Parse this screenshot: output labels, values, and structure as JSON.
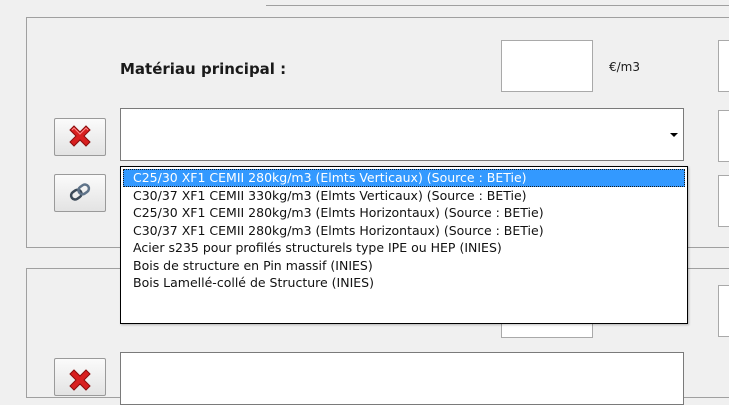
{
  "section1": {
    "label": "Matériau principal :",
    "price_unit": "€/m3",
    "price_value": "",
    "combo_value": ""
  },
  "dropdown": {
    "options": [
      "C25/30 XF1 CEMII 280kg/m3 (Elmts Verticaux) (Source : BETie)",
      "C30/37 XF1 CEMII 330kg/m3 (Elmts Verticaux) (Source : BETie)",
      "C25/30 XF1 CEMII 280kg/m3 (Elmts Horizontaux) (Source : BETie)",
      "C30/37 XF1 CEMII 280kg/m3 (Elmts Horizontaux) (Source : BETie)",
      "Acier s235 pour profilés structurels type IPE ou HEP (INIES)",
      "Bois de structure en Pin massif (INIES)",
      "Bois Lamellé-collé de Structure (INIES)"
    ],
    "selected_index": 0
  },
  "icons": {
    "delete": "red-x-icon",
    "link": "chain-link-icon"
  },
  "colors": {
    "window_bg": "#f0f0f0",
    "selection": "#3399ff",
    "delete_red": "#d81f1f"
  }
}
